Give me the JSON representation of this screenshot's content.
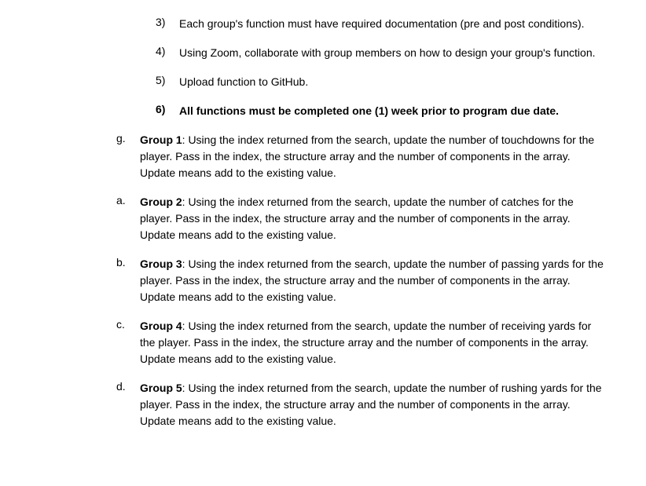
{
  "numbered": [
    {
      "marker": "3)",
      "text": "Each group's function must have required documentation (pre and post conditions).",
      "bold": false
    },
    {
      "marker": "4)",
      "text": "Using Zoom, collaborate with group members on how to design your group's function.",
      "bold": false
    },
    {
      "marker": "5)",
      "text": "Upload function to GitHub.",
      "bold": false
    },
    {
      "marker": "6)",
      "text": "All functions must be completed one (1) week prior to program due date.",
      "bold": true
    }
  ],
  "groups": [
    {
      "marker": "g.",
      "label": "Group 1",
      "text": ":  Using the index returned from the search, update the number of touchdowns for the player.  Pass in the index, the structure array and the number of components in the array.  Update means add to the existing value."
    },
    {
      "marker": "a.",
      "label": "Group 2",
      "text": ":  Using the index returned from the search, update the number of catches for the player.  Pass in the index, the structure array and the number of components in the array.  Update means add to the existing value."
    },
    {
      "marker": "b.",
      "label": "Group 3",
      "text": ":  Using the index returned from the search, update the number of passing yards for the player.  Pass in the index, the structure array and the number of components in the array.  Update means add to the existing value."
    },
    {
      "marker": "c.",
      "label": "Group 4",
      "text": ":  Using the index returned from the search, update the number of receiving yards for the player.  Pass in the index, the structure array and the number of components in the array.  Update means add to the existing value."
    },
    {
      "marker": "d.",
      "label": "Group 5",
      "text": ":  Using the index returned from the search, update the number of rushing yards for the player.  Pass in the index, the structure array and the number of components in the array.  Update means add to the existing value."
    }
  ]
}
